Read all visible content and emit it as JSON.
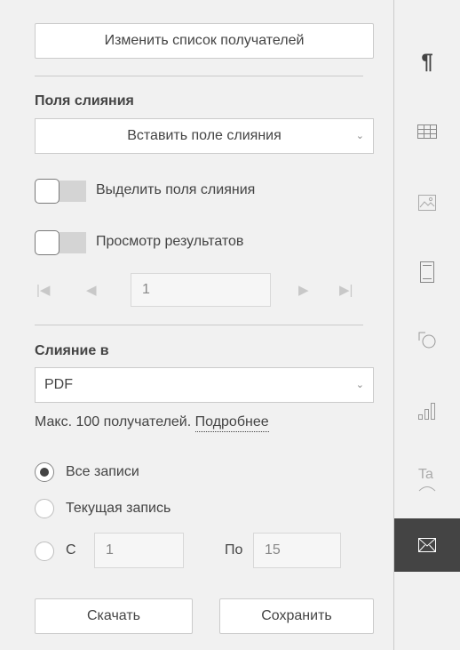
{
  "recipients_button": "Изменить список получателей",
  "merge_fields": {
    "heading": "Поля слияния",
    "insert_dropdown": "Вставить поле слияния",
    "highlight_label": "Выделить поля слияния",
    "preview_label": "Просмотр результатов",
    "record_number": "1"
  },
  "merge_to": {
    "heading": "Слияние в",
    "format_value": "PDF",
    "limit_text": "Макс. 100 получателей.",
    "more_link": "Подробнее"
  },
  "records": {
    "all": "Все записи",
    "current": "Текущая запись",
    "from_label": "С",
    "from_value": "1",
    "to_label": "По",
    "to_value": "15",
    "selected": "all"
  },
  "actions": {
    "download": "Скачать",
    "save": "Сохранить"
  },
  "rightbar": {
    "items": [
      {
        "icon": "paragraph-icon",
        "glyph": "¶"
      },
      {
        "icon": "table-icon"
      },
      {
        "icon": "image-icon"
      },
      {
        "icon": "header-footer-icon"
      },
      {
        "icon": "shape-icon"
      },
      {
        "icon": "chart-icon"
      },
      {
        "icon": "textart-icon",
        "glyph": "Ta"
      },
      {
        "icon": "mail-merge-icon",
        "active": true
      }
    ]
  },
  "colors": {
    "active_bg": "#444444",
    "panel_bg": "#f1f1f1",
    "border": "#cbcbcb"
  }
}
